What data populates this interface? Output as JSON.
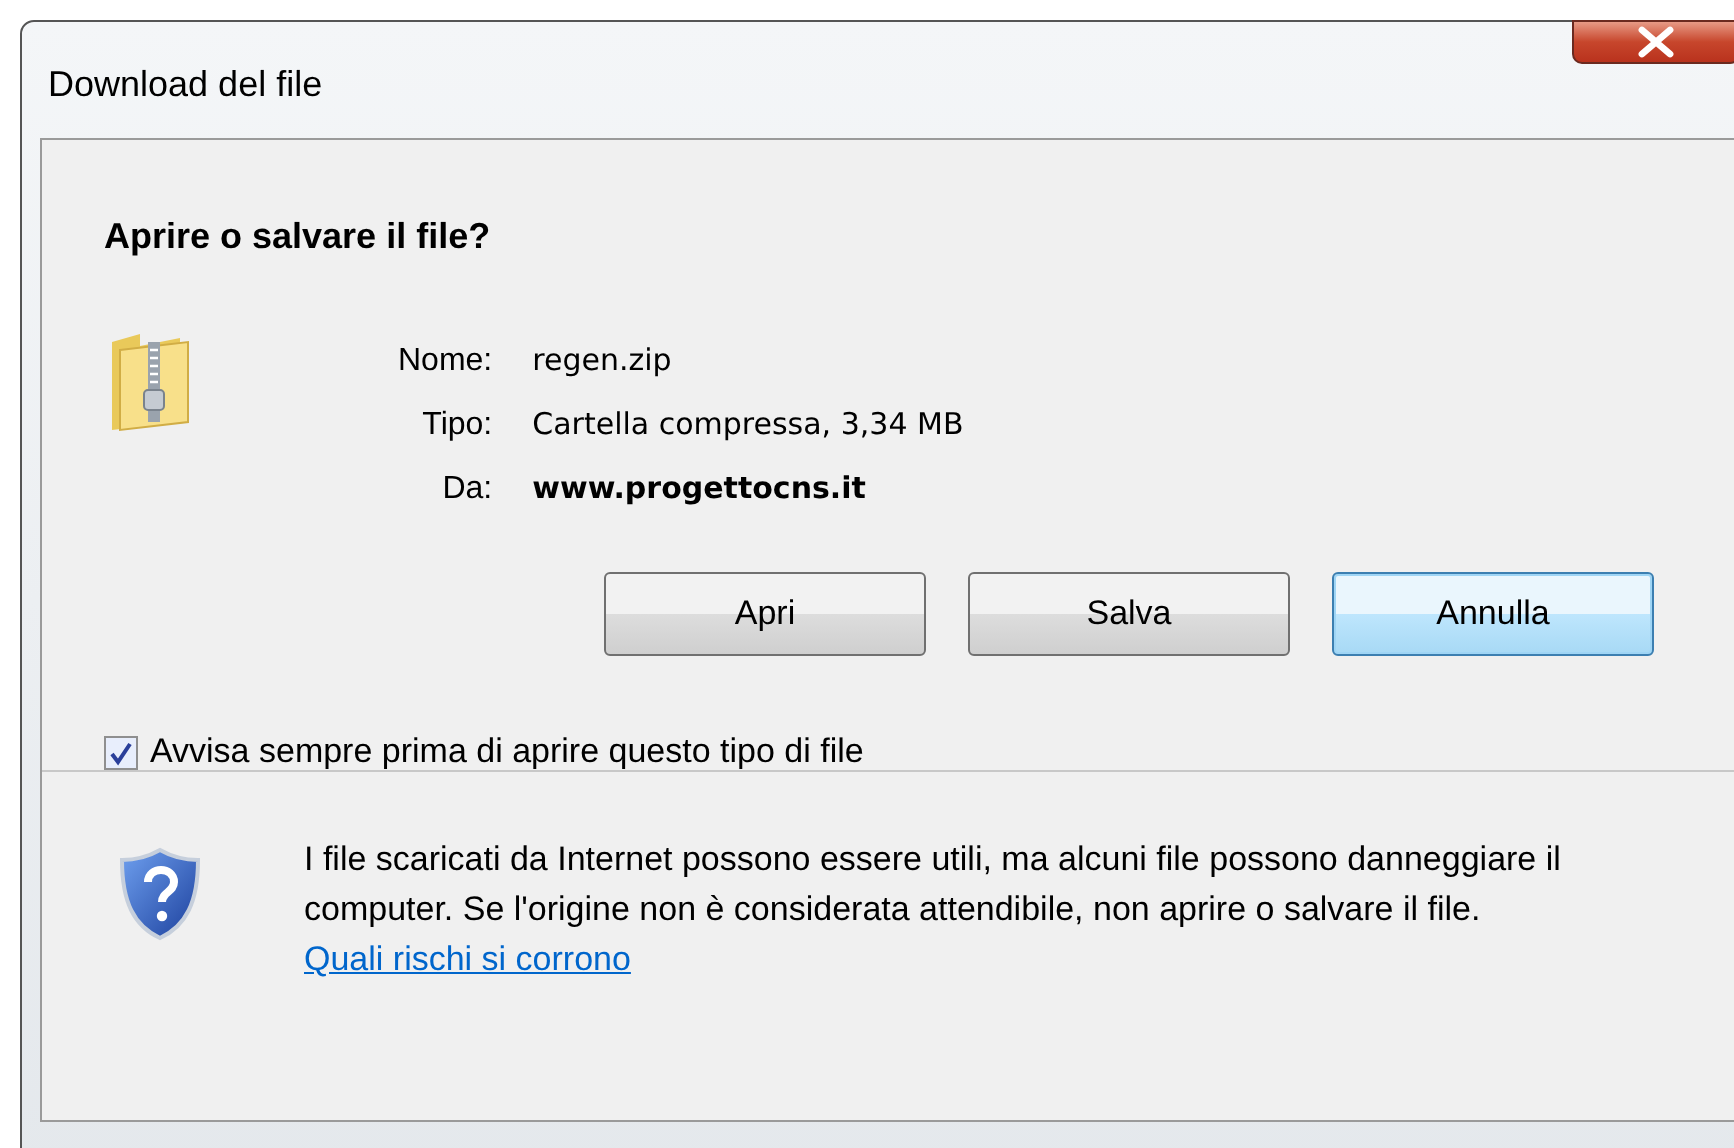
{
  "window": {
    "title": "Download del file"
  },
  "heading": "Aprire o salvare il file?",
  "details": [
    {
      "label": "Nome:",
      "value": "regen.zip",
      "kind": "plain"
    },
    {
      "label": "Tipo:",
      "value": "Cartella compressa, 3,34 MB",
      "kind": "plain"
    },
    {
      "label": "Da:",
      "value": "www.progettocns.it",
      "kind": "strong"
    }
  ],
  "buttons": [
    {
      "label": "Apri",
      "default": false
    },
    {
      "label": "Salva",
      "default": false
    },
    {
      "label": "Annulla",
      "default": true
    }
  ],
  "always_ask": {
    "label": "Avvisa sempre prima di aprire questo tipo di file",
    "checked": true
  },
  "warning": {
    "text": "I file scaricati da Internet possono essere utili, ma alcuni file possono danneggiare il computer. Se l'origine non è considerata attendibile, non aprire o salvare il file.",
    "link": "Quali rischi si corrono"
  }
}
